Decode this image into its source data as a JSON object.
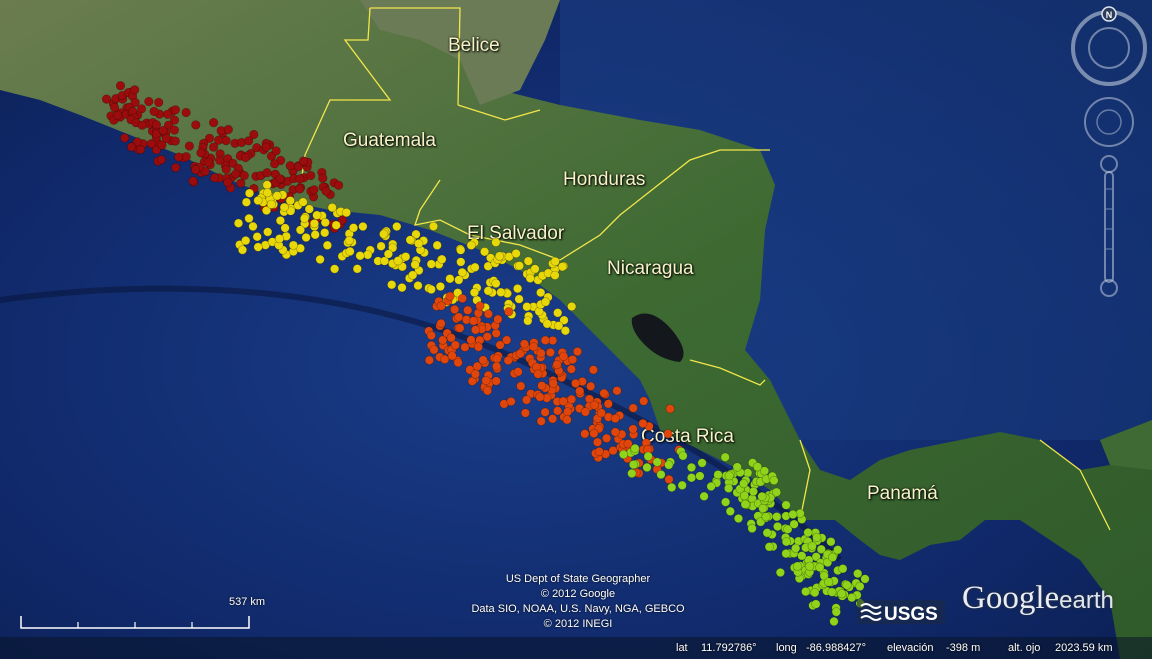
{
  "map": {
    "countries": [
      {
        "name": "Belice"
      },
      {
        "name": "Guatemala"
      },
      {
        "name": "Honduras"
      },
      {
        "name": "El Salvador"
      },
      {
        "name": "Nicaragua"
      },
      {
        "name": "Costa Rica"
      },
      {
        "name": "Panamá"
      }
    ],
    "colors": {
      "ocean": "#0e2a6b",
      "land": "#4f6e3a",
      "border": "#f2e64a",
      "cluster_red": "#9b0d0d",
      "cluster_yellow": "#e8d80a",
      "cluster_orange": "#e0460c",
      "cluster_green": "#8fd31a"
    },
    "marker_clusters": [
      {
        "color_name": "red",
        "region": "Guatemala"
      },
      {
        "color_name": "yellow",
        "region": "El Salvador"
      },
      {
        "color_name": "orange",
        "region": "Nicaragua"
      },
      {
        "color_name": "green",
        "region": "Costa Rica / Panamá"
      }
    ]
  },
  "credits": [
    "US Dept of State Geographer",
    "© 2012 Google",
    "Data SIO, NOAA, U.S. Navy, NGA, GEBCO",
    "© 2012 INEGI"
  ],
  "scale": {
    "label": "537 km"
  },
  "status": {
    "lat_label": "lat",
    "lat_value": "11.792786°",
    "long_label": "long",
    "long_value": "-86.988427°",
    "elev_label": "elevación",
    "elev_value": "-398 m",
    "eye_label": "alt. ojo",
    "eye_value": "2023.59 km"
  },
  "logos": {
    "usgs": "USGS",
    "google": "Google",
    "earth": "earth"
  },
  "nav": {
    "north": "N",
    "icons": [
      "compass-ring-icon",
      "look-joystick-icon",
      "zoom-slider-icon"
    ]
  }
}
